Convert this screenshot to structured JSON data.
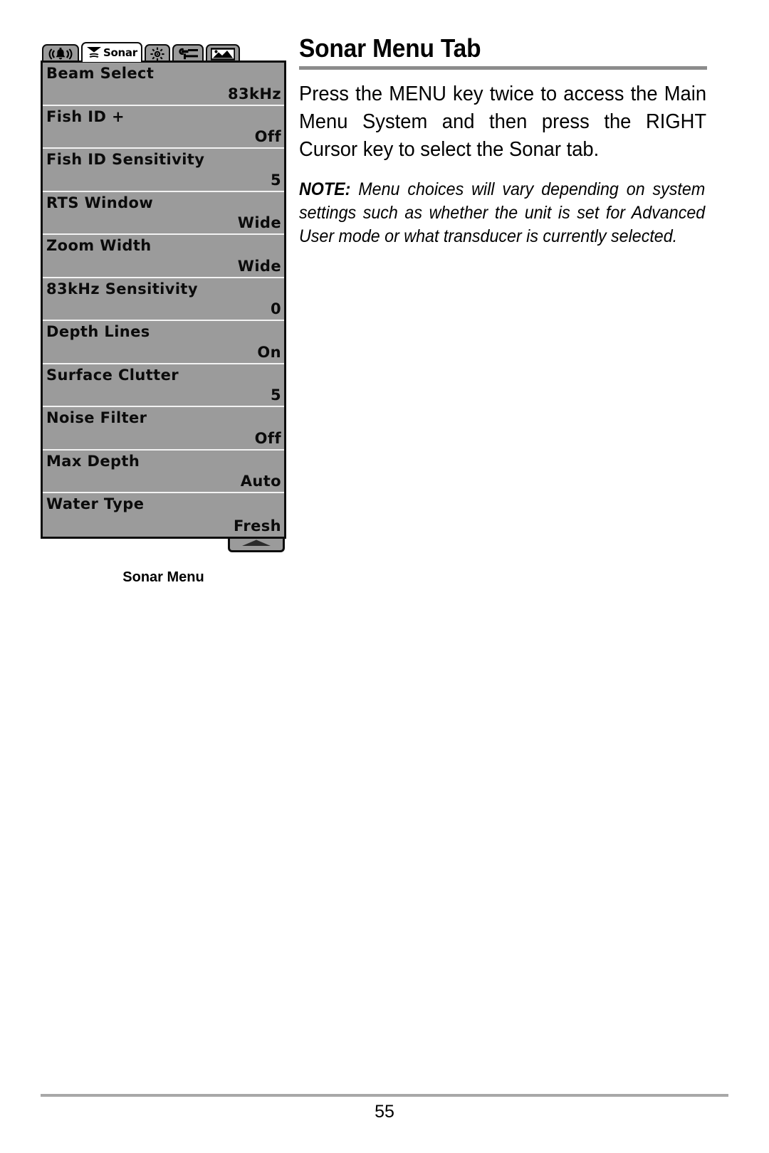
{
  "document": {
    "page_number": "55"
  },
  "heading": {
    "title": "Sonar Menu Tab"
  },
  "body": {
    "paragraph": "Press the MENU key twice to access the Main Menu System and then press the RIGHT Cursor key to select the Sonar tab.",
    "note_label": "NOTE:",
    "note_text": " Menu choices will vary depending on system settings such as whether the unit is set for Advanced User mode or what transducer is currently selected."
  },
  "figure": {
    "caption": "Sonar Menu",
    "tabs": [
      {
        "id": "alarms",
        "icon": "alarm-bell-icon",
        "label": "",
        "active": false
      },
      {
        "id": "sonar",
        "icon": "sonar-beam-icon",
        "label": "Sonar",
        "active": true
      },
      {
        "id": "setup-brightness",
        "icon": "sun-brightness-icon",
        "label": "",
        "active": false
      },
      {
        "id": "setup",
        "icon": "wrench-setup-icon",
        "label": "",
        "active": false
      },
      {
        "id": "views",
        "icon": "views-screen-icon",
        "label": "",
        "active": false
      }
    ],
    "menu_items": [
      {
        "label": "Beam Select",
        "value": "83kHz"
      },
      {
        "label": "Fish ID +",
        "value": "Off"
      },
      {
        "label": "Fish ID Sensitivity",
        "value": "5"
      },
      {
        "label": "RTS Window",
        "value": "Wide"
      },
      {
        "label": "Zoom Width",
        "value": "Wide"
      },
      {
        "label": "83kHz Sensitivity",
        "value": "0"
      },
      {
        "label": "Depth Lines",
        "value": "On"
      },
      {
        "label": "Surface Clutter",
        "value": "5"
      },
      {
        "label": "Noise Filter",
        "value": "Off"
      },
      {
        "label": "Max Depth",
        "value": "Auto"
      },
      {
        "label": "Water Type",
        "value": "Fresh"
      }
    ],
    "scroll_indicator": "scroll-up-arrow-icon",
    "colors": {
      "lcd_background": "#9b9b9b",
      "lcd_border": "#0d0d0d",
      "lcd_text": "#0b0b0b",
      "active_tab_background": "#ffffff",
      "rule": "#8c8c8c"
    }
  }
}
